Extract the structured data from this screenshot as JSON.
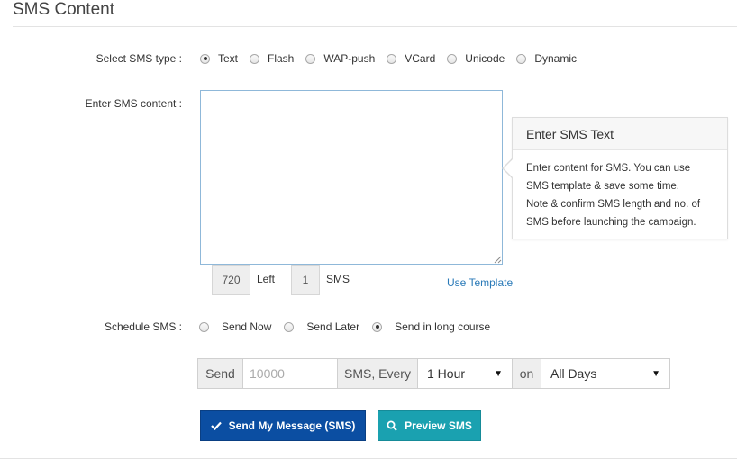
{
  "section": {
    "title": "SMS Content"
  },
  "sms_type": {
    "label": "Select SMS type :",
    "options": [
      "Text",
      "Flash",
      "WAP-push",
      "VCard",
      "Unicode",
      "Dynamic"
    ],
    "selected": "Text"
  },
  "content": {
    "label": "Enter SMS content :",
    "value": "",
    "chars_left": "720",
    "left_label": "Left",
    "sms_count": "1",
    "sms_label": "SMS",
    "use_template": "Use Template"
  },
  "tooltip": {
    "title": "Enter SMS Text",
    "lines": [
      "Enter content for SMS. You can use",
      "SMS template & save some time.",
      "Note & confirm SMS length and no. of",
      "SMS before launching the campaign."
    ]
  },
  "schedule": {
    "label": "Schedule SMS :",
    "options": [
      "Send Now",
      "Send Later",
      "Send in long course"
    ],
    "selected": "Send in long course"
  },
  "long_course": {
    "send_label": "Send",
    "quantity_placeholder": "10000",
    "every_label": "SMS, Every",
    "interval": "1 Hour",
    "on_label": "on",
    "days": "All Days"
  },
  "actions": {
    "send": "Send My Message (SMS)",
    "preview": "Preview SMS"
  },
  "colors": {
    "primary": "#0b4ea2",
    "info": "#1aa1b0",
    "link": "#2a7ab8"
  }
}
